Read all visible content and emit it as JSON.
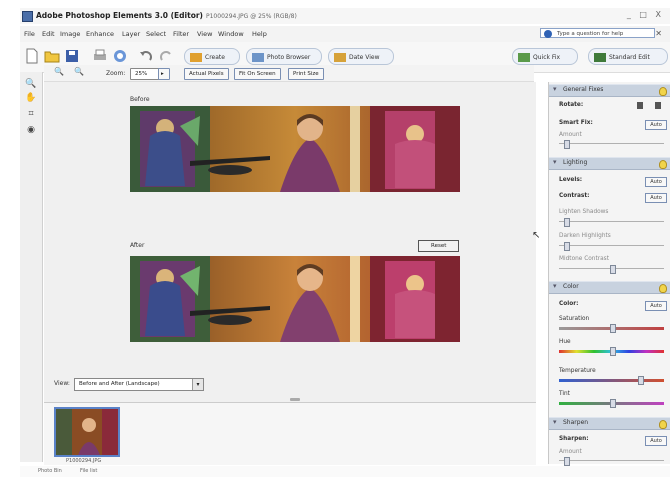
{
  "window": {
    "app_title": "Adobe Photoshop Elements 3.0 (Editor)",
    "file_title": "P1000294.JPG @ 25% (RGB/8)",
    "controls": "_ □ X"
  },
  "menu": [
    "File",
    "Edit",
    "Image",
    "Enhance",
    "Layer",
    "Select",
    "Filter",
    "View",
    "Window",
    "Help"
  ],
  "help_box": {
    "placeholder": "Type a question for help"
  },
  "toolbar": {
    "create": "Create",
    "photo_browser": "Photo Browser",
    "date_view": "Date View",
    "quick_fix": "Quick Fix",
    "standard_edit": "Standard Edit"
  },
  "options": {
    "zoom_label": "Zoom:",
    "zoom_value": "25%",
    "actual_pixels": "Actual Pixels",
    "fit_on_screen": "Fit On Screen",
    "print_size": "Print Size"
  },
  "canvas": {
    "before_label": "Before",
    "after_label": "After",
    "reset_label": "Reset",
    "view_label": "View:",
    "view_value": "Before and After (Landscape)"
  },
  "bin": {
    "thumb_caption": "P1000294.JPG"
  },
  "status": {
    "text": "Photo Bin",
    "text2": "File list"
  },
  "palette": {
    "general_fixes": {
      "title": "General Fixes",
      "rotate": "Rotate:",
      "smart_fix": "Smart Fix:",
      "amount": "Amount",
      "auto": "Auto",
      "amount_level": 0.05
    },
    "lighting": {
      "title": "Lighting",
      "levels": "Levels:",
      "contrast": "Contrast:",
      "auto": "Auto",
      "lighten_shadows": "Lighten Shadows",
      "darken_highlights": "Darken Highlights",
      "midtone_contrast": "Midtone Contrast",
      "lighten_level": 0.05,
      "darken_level": 0.05,
      "midtone_level": 0.5
    },
    "color": {
      "title": "Color",
      "color_label": "Color:",
      "auto": "Auto",
      "saturation": "Saturation",
      "hue": "Hue",
      "temperature": "Temperature",
      "tint": "Tint",
      "saturation_level": 0.5,
      "hue_level": 0.5,
      "temperature_level": 0.78,
      "tint_level": 0.5
    },
    "sharpen": {
      "title": "Sharpen",
      "sharpen_label": "Sharpen:",
      "auto": "Auto",
      "amount": "Amount",
      "amount_level": 0.05
    }
  }
}
